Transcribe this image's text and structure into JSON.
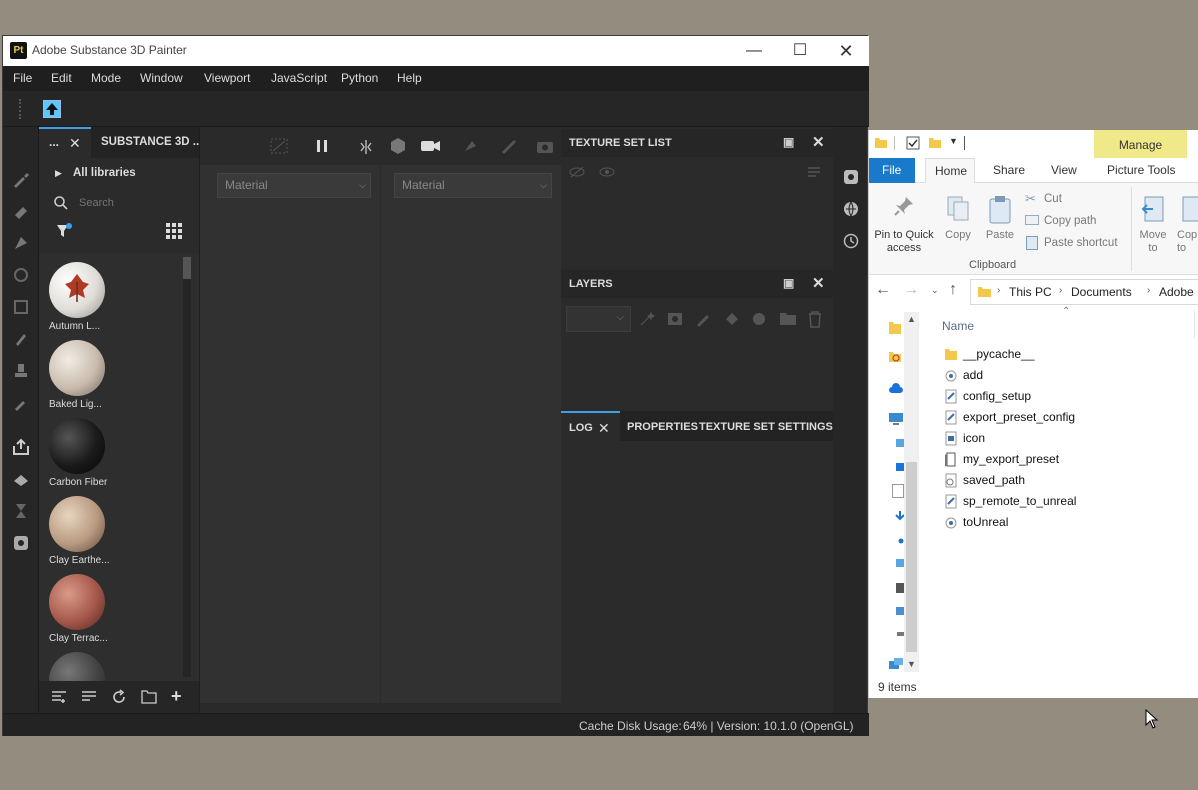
{
  "painter": {
    "title": "Adobe Substance 3D Painter",
    "logo": "Pt",
    "menu": [
      "File",
      "Edit",
      "Mode",
      "Window",
      "Viewport",
      "JavaScript",
      "Python",
      "Help"
    ],
    "shelf": {
      "tab_label": "...",
      "title": "SUBSTANCE 3D ...",
      "all_libraries": "All libraries",
      "search_placeholder": "Search",
      "materials": [
        {
          "label": "Autumn L...",
          "color": "#e8e6e2"
        },
        {
          "label": "Baked Lig...",
          "color": "#c9bcae"
        },
        {
          "label": "Carbon Fiber",
          "color": "#1a1a1a"
        },
        {
          "label": "Clay Earthe...",
          "color": "#b89a80"
        },
        {
          "label": "Clay Terrac...",
          "color": "#a5574a"
        }
      ]
    },
    "viewport": {
      "select_left": "Material",
      "select_right": "Material"
    },
    "panels": {
      "texture_set_list": "TEXTURE SET LIST",
      "layers": "LAYERS",
      "log": "LOG",
      "properties": "PROPERTIES",
      "texture_set_settings": "TEXTURE SET SETTINGS"
    },
    "status": {
      "cache_label": "Cache Disk Usage:",
      "cache_value": "64% | Version: 10.1.0 (OpenGL)"
    }
  },
  "explorer": {
    "manage": "Manage",
    "picture_tools": "Picture Tools",
    "tabs": [
      "File",
      "Home",
      "Share",
      "View"
    ],
    "ribbon": {
      "pin": "Pin to Quick access",
      "copy": "Copy",
      "paste": "Paste",
      "cut": "Cut",
      "copy_path": "Copy path",
      "paste_shortcut": "Paste shortcut",
      "clipboard": "Clipboard",
      "move_to": "Move to",
      "copy_to": "Cop to"
    },
    "breadcrumb": [
      "This PC",
      "Documents",
      "Adobe"
    ],
    "column_name": "Name",
    "files": [
      {
        "name": "__pycache__",
        "type": "folder"
      },
      {
        "name": "add",
        "type": "py"
      },
      {
        "name": "config_setup",
        "type": "script"
      },
      {
        "name": "export_preset_config",
        "type": "script"
      },
      {
        "name": "icon",
        "type": "image"
      },
      {
        "name": "my_export_preset",
        "type": "doc"
      },
      {
        "name": "saved_path",
        "type": "gear"
      },
      {
        "name": "sp_remote_to_unreal",
        "type": "script"
      },
      {
        "name": "toUnreal",
        "type": "py"
      }
    ],
    "item_count": "9 items"
  }
}
